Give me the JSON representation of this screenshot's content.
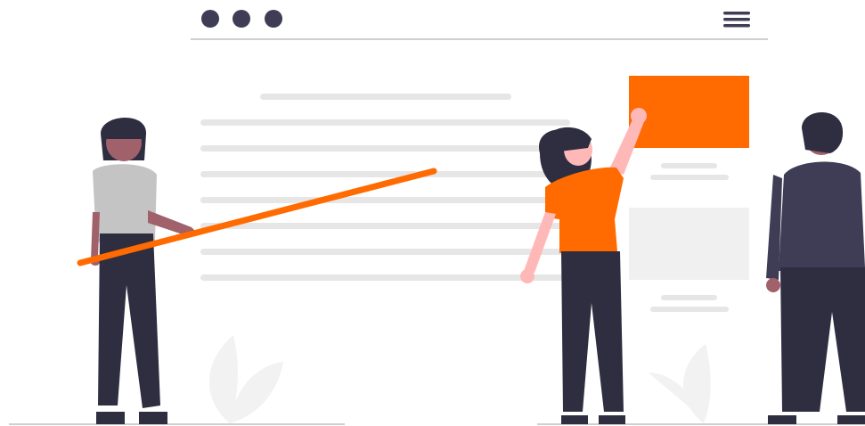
{
  "scene": {
    "accent_color": "#ff6b00",
    "ink_color": "#3f3d56",
    "placeholder_color": "#e6e6e6",
    "window_dots": [
      "window-dot",
      "window-dot",
      "window-dot"
    ],
    "menu_icon": "hamburger-menu-icon"
  }
}
